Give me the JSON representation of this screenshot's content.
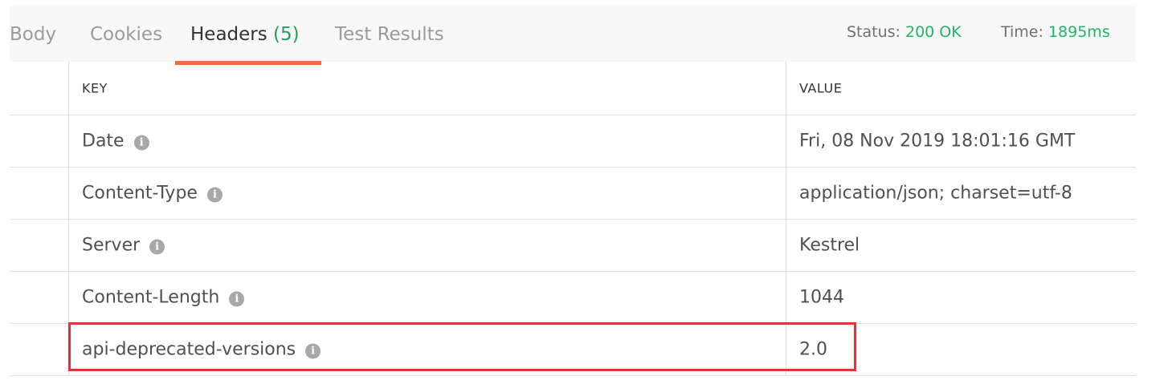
{
  "tabs": [
    {
      "label": "Body"
    },
    {
      "label": "Cookies"
    },
    {
      "label": "Headers",
      "count": "(5)"
    },
    {
      "label": "Test Results"
    }
  ],
  "status": {
    "status_label": "Status:",
    "status_value": "200 OK",
    "time_label": "Time:",
    "time_value": "1895ms"
  },
  "table": {
    "columns": [
      "KEY",
      "VALUE"
    ],
    "rows": [
      {
        "key": "Date",
        "value": "Fri, 08 Nov 2019 18:01:16 GMT"
      },
      {
        "key": "Content-Type",
        "value": "application/json; charset=utf-8"
      },
      {
        "key": "Server",
        "value": "Kestrel"
      },
      {
        "key": "Content-Length",
        "value": "1044"
      },
      {
        "key": "api-deprecated-versions",
        "value": "2.0"
      }
    ],
    "info_icon": "info-icon",
    "highlighted_row": 4
  },
  "colors": {
    "accent_tab": "#f26b3a",
    "status_ok": "#21b466",
    "highlight": "#e03436"
  }
}
